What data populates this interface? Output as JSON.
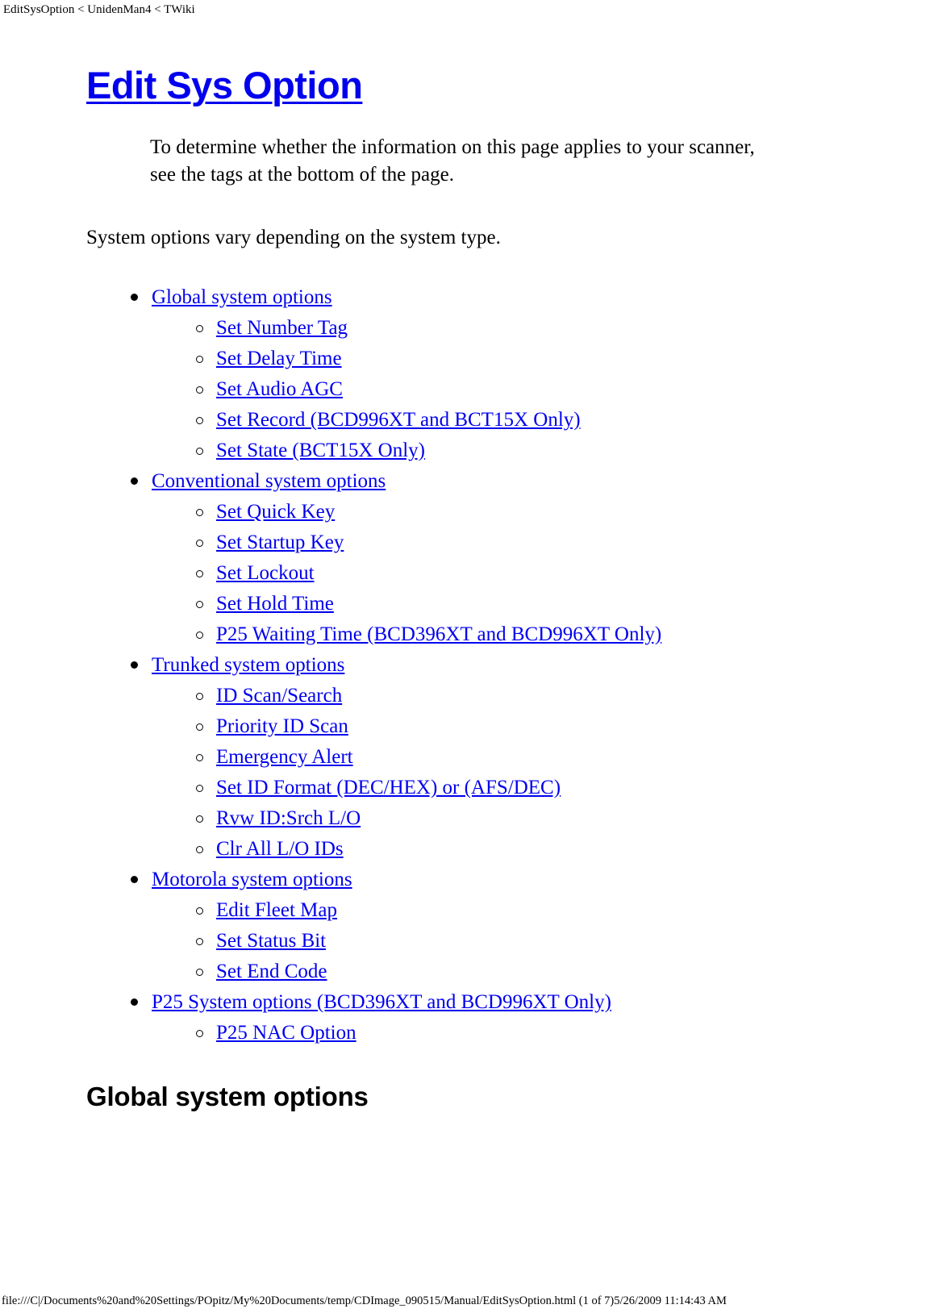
{
  "window": {
    "header_text": "EditSysOption < UnidenMan4 < TWiki",
    "footer_text": "file:///C|/Documents%20and%20Settings/POpitz/My%20Documents/temp/CDImage_090515/Manual/EditSysOption.html (1 of 7)5/26/2009 11:14:43 AM"
  },
  "colors": {
    "link": "#0000EE",
    "text": "#000000",
    "background": "#FFFFFF"
  },
  "document": {
    "title": "Edit Sys Option",
    "intro_note": "To determine whether the information on this page applies to your scanner, see the tags at the bottom of the page.",
    "intro_paragraph": "System options vary depending on the system type.",
    "section_heading": "Global system options"
  },
  "toc": [
    {
      "label": "Global system options",
      "children": [
        {
          "label": "Set Number Tag"
        },
        {
          "label": "Set Delay Time"
        },
        {
          "label": "Set Audio AGC"
        },
        {
          "label": "Set Record (BCD996XT and BCT15X Only)"
        },
        {
          "label": "Set State (BCT15X Only)"
        }
      ]
    },
    {
      "label": "Conventional system options",
      "children": [
        {
          "label": "Set Quick Key"
        },
        {
          "label": "Set Startup Key"
        },
        {
          "label": "Set Lockout"
        },
        {
          "label": "Set Hold Time"
        },
        {
          "label": "P25 Waiting Time (BCD396XT and BCD996XT Only)"
        }
      ]
    },
    {
      "label": "Trunked system options",
      "children": [
        {
          "label": "ID Scan/Search"
        },
        {
          "label": "Priority ID Scan"
        },
        {
          "label": "Emergency Alert"
        },
        {
          "label": "Set ID Format (DEC/HEX) or (AFS/DEC)"
        },
        {
          "label": "Rvw ID:Srch L/O"
        },
        {
          "label": "Clr All L/O IDs"
        }
      ]
    },
    {
      "label": "Motorola system options",
      "children": [
        {
          "label": "Edit Fleet Map"
        },
        {
          "label": "Set Status Bit"
        },
        {
          "label": "Set End Code"
        }
      ]
    },
    {
      "label": "P25 System options (BCD396XT and BCD996XT Only)",
      "children": [
        {
          "label": "P25 NAC Option"
        }
      ]
    }
  ]
}
